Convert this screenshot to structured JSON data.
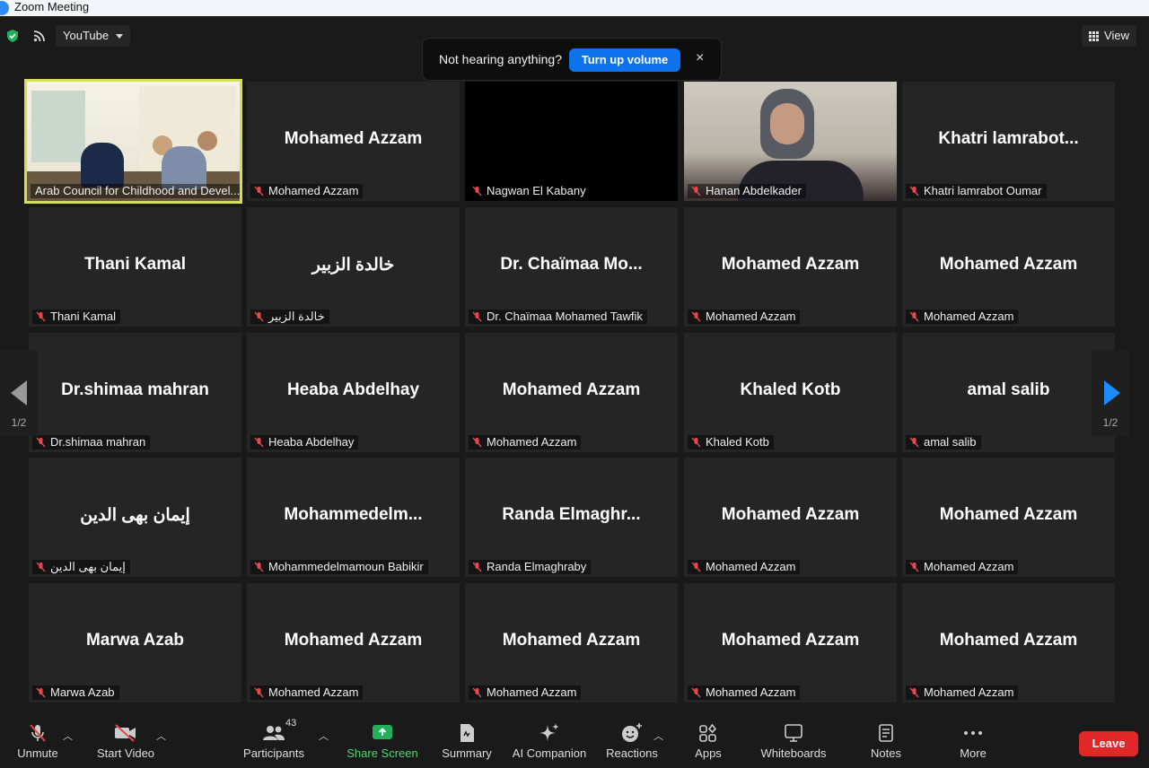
{
  "window": {
    "title": "Zoom Meeting"
  },
  "topbar": {
    "stream_label": "YouTube",
    "view_label": "View"
  },
  "toast": {
    "message": "Not hearing anything?",
    "button": "Turn up volume",
    "close": "×"
  },
  "pager": {
    "left": "1/2",
    "right": "1/2"
  },
  "tiles": [
    {
      "big": "",
      "name": "Arab Council for Childhood and Devel..."
    },
    {
      "big": "Mohamed Azzam",
      "name": "Mohamed Azzam"
    },
    {
      "big": "",
      "name": "Nagwan El Kabany"
    },
    {
      "big": "",
      "name": "Hanan Abdelkader"
    },
    {
      "big": "Khatri  lamrabot...",
      "name": "Khatri lamrabot Oumar"
    },
    {
      "big": "Thani Kamal",
      "name": "Thani Kamal"
    },
    {
      "big": "خالدة الزبير",
      "name": "خالدة الزبير"
    },
    {
      "big": "Dr.  Chaïmaa  Mo...",
      "name": "Dr. Chaïmaa Mohamed Tawfik"
    },
    {
      "big": "Mohamed Azzam",
      "name": "Mohamed Azzam"
    },
    {
      "big": "Mohamed Azzam",
      "name": "Mohamed Azzam"
    },
    {
      "big": "Dr.shimaa mahran",
      "name": "Dr.shimaa mahran"
    },
    {
      "big": "Heaba Abdelhay",
      "name": "Heaba Abdelhay"
    },
    {
      "big": "Mohamed Azzam",
      "name": "Mohamed Azzam"
    },
    {
      "big": "Khaled Kotb",
      "name": "Khaled Kotb"
    },
    {
      "big": "amal salib",
      "name": "amal salib"
    },
    {
      "big": "إيمان بهى الدين",
      "name": "إيمان بهى الدين"
    },
    {
      "big": "Mohammedelm...",
      "name": "Mohammedelmamoun Babikir"
    },
    {
      "big": "Randa  Elmaghr...",
      "name": "Randa Elmaghraby"
    },
    {
      "big": "Mohamed Azzam",
      "name": "Mohamed Azzam"
    },
    {
      "big": "Mohamed Azzam",
      "name": "Mohamed Azzam"
    },
    {
      "big": "Marwa Azab",
      "name": "Marwa Azab"
    },
    {
      "big": "Mohamed Azzam",
      "name": "Mohamed Azzam"
    },
    {
      "big": "Mohamed Azzam",
      "name": "Mohamed Azzam"
    },
    {
      "big": "Mohamed Azzam",
      "name": "Mohamed Azzam"
    },
    {
      "big": "Mohamed Azzam",
      "name": "Mohamed Azzam"
    }
  ],
  "toolbar": {
    "unmute": "Unmute",
    "start_video": "Start Video",
    "participants": "Participants",
    "participants_count": "43",
    "share_screen": "Share Screen",
    "summary": "Summary",
    "ai_companion": "AI Companion",
    "reactions": "Reactions",
    "apps": "Apps",
    "whiteboards": "Whiteboards",
    "notes": "Notes",
    "more": "More",
    "leave": "Leave"
  },
  "colors": {
    "accent_blue": "#0e72ed",
    "share_green": "#4fd66e",
    "leave_red": "#e02828",
    "active_speaker": "#d4e04f"
  }
}
